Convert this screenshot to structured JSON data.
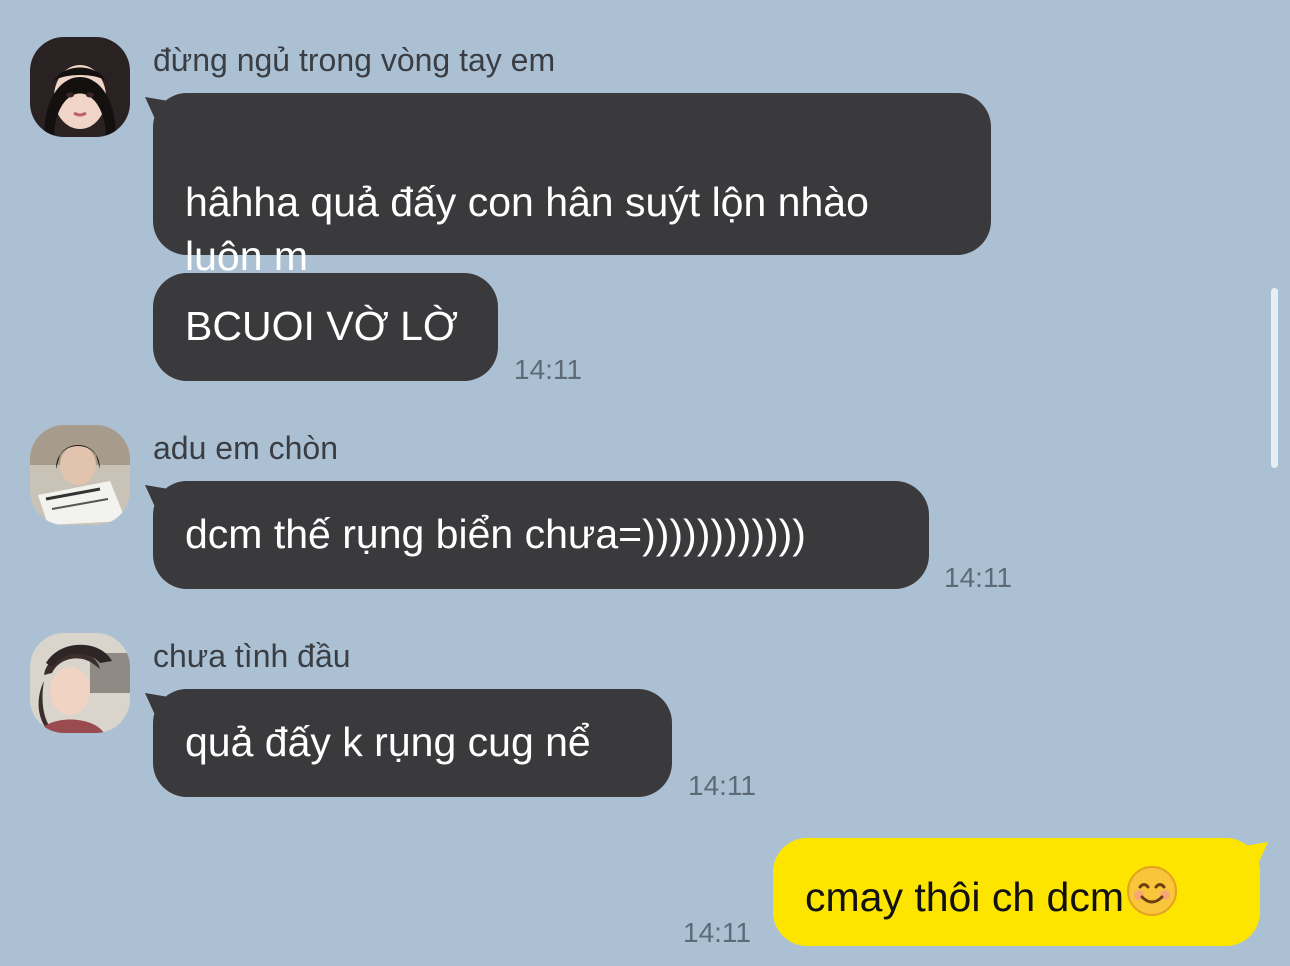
{
  "chat": {
    "messages": [
      {
        "sender": "đừng ngủ trong vòng tay em",
        "bubbles": [
          "hâhha quả đấy con hân suýt lộn nhào\nluôn m",
          "BCUOI VỜ LỜ"
        ],
        "time": "14:11"
      },
      {
        "sender": "adu em chòn",
        "bubbles": [
          "dcm thế rụng biển chưa=))))))))))))"
        ],
        "time": "14:11"
      },
      {
        "sender": "chưa tình đầu",
        "bubbles": [
          "quả đấy k rụng cug nể"
        ],
        "time": "14:11"
      }
    ],
    "my_message": {
      "text": "cmay thôi ch dcm",
      "emoji": "smiling-face-emoji",
      "time": "14:11"
    }
  },
  "colors": {
    "background": "#abc1d3",
    "their_bubble": "#3a3a3d",
    "my_bubble": "#fee500",
    "timestamp": "#5d6b78"
  }
}
